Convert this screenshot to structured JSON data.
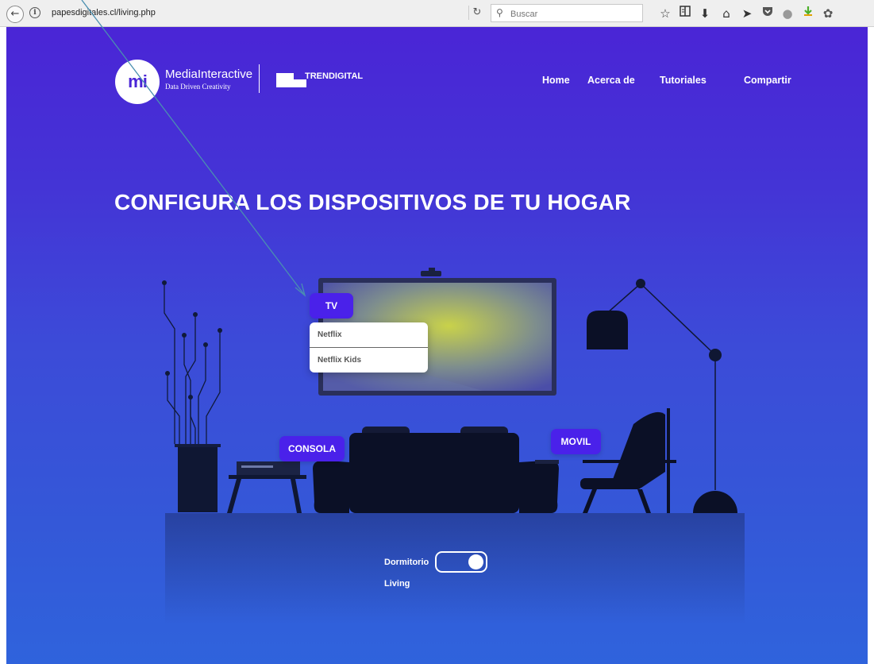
{
  "browser": {
    "url": "papesdigitales.cl/living.php",
    "search_placeholder": "Buscar",
    "icons": [
      "back-arrow-icon",
      "info-icon",
      "reload-icon",
      "search-icon",
      "bookmark-star-icon",
      "reading-list-icon",
      "download-icon",
      "home-icon",
      "send-icon",
      "pocket-icon",
      "extension-icon",
      "addon-icon",
      "extension-puzzle-icon"
    ]
  },
  "header": {
    "logo_initials": "mi",
    "brand_name": "MediaInteractive",
    "brand_tagline": "Data Driven Creativity",
    "partner_name": "TRENDIGITAL",
    "nav": [
      "Home",
      "Acerca de",
      "Tutoriales",
      "Compartir"
    ]
  },
  "hero": {
    "title": "CONFIGURA LOS DISPOSITIVOS DE TU HOGAR"
  },
  "devices": {
    "tv_label": "TV",
    "console_label": "CONSOLA",
    "mobile_label": "MOVIL",
    "tv_menu": [
      "Netflix",
      "Netflix Kids"
    ]
  },
  "room_toggle": {
    "option_top": "Dormitorio",
    "option_bottom": "Living",
    "state": "on"
  },
  "colors": {
    "accent": "#4a21ea",
    "bg_top": "#4a25d6",
    "bg_bottom": "#2f63dc",
    "furniture": "#0f1733"
  }
}
